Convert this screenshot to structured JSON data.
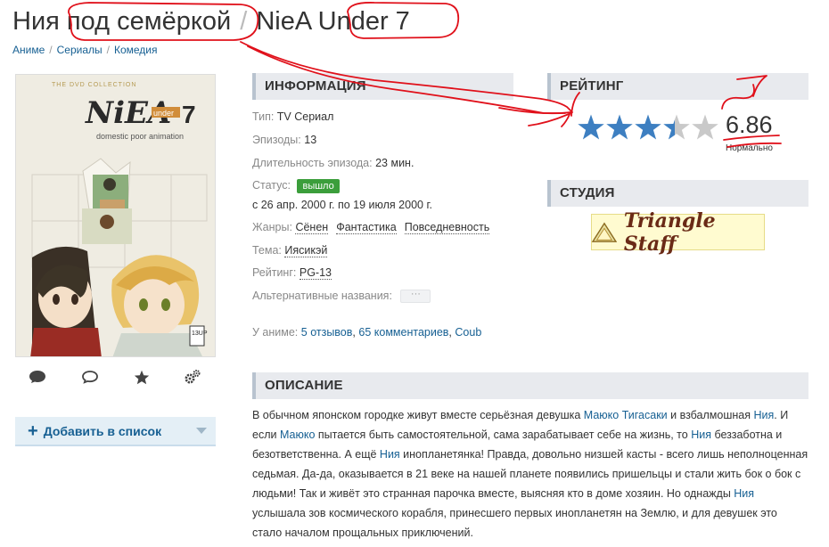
{
  "header": {
    "title_ru": "Ния под семёркой",
    "separator": "/",
    "title_en": "NieA Under 7"
  },
  "breadcrumbs": [
    "Аниме",
    "Сериалы",
    "Комедия"
  ],
  "poster": {
    "collection_text": "THE DVD COLLECTION",
    "logo_main": "NiEA",
    "logo_sub": "under",
    "logo_num": "7",
    "tagline": "domestic poor animation",
    "rating_stamp": "13UP"
  },
  "poster_icons": [
    "comment-icon",
    "comments-icon",
    "star-icon",
    "gears-icon"
  ],
  "add_to_list": {
    "label": "Добавить в список"
  },
  "info": {
    "heading": "ИНФОРМАЦИЯ",
    "type_label": "Тип:",
    "type_value": "TV Сериал",
    "episodes_label": "Эпизоды:",
    "episodes_value": "13",
    "duration_label": "Длительность эпизода:",
    "duration_value": "23 мин.",
    "status_label": "Статус:",
    "status_value": "вышло",
    "dates": "с 26 апр. 2000 г. по 19 июля 2000 г.",
    "genres_label": "Жанры:",
    "genres": [
      "Сёнен",
      "Фантастика",
      "Повседневность"
    ],
    "theme_label": "Тема:",
    "theme_value": "Иясикэй",
    "rating_label": "Рейтинг:",
    "rating_value": "PG-13",
    "alt_names_label": "Альтернативные названия:",
    "alt_names_button": "···",
    "in_anime_label": "У аниме:",
    "in_anime_links": [
      "5 отзывов",
      "65 комментариев",
      "Coub"
    ],
    "link_separator": ","
  },
  "rating": {
    "heading": "РЕЙТИНГ",
    "score": "6.86",
    "score_label": "Нормально",
    "stars_filled": 3.43,
    "stars_total": 5,
    "star_color": "#3d7fc1",
    "star_empty_color": "#c9c9c9"
  },
  "studio": {
    "heading": "СТУДИЯ",
    "name": "Triangle Staff"
  },
  "description": {
    "heading": "ОПИСАНИЕ",
    "parts": [
      {
        "t": "В обычном японском городке живут вместе серьёзная девушка "
      },
      {
        "t": "Маюко Тигасаки",
        "link": true
      },
      {
        "t": " и взбалмошная "
      },
      {
        "t": "Ния",
        "link": true
      },
      {
        "t": ". И если "
      },
      {
        "t": "Маюко",
        "link": true
      },
      {
        "t": " пытается быть самостоятельной, сама зарабатывает себе на жизнь, то "
      },
      {
        "t": "Ния",
        "link": true
      },
      {
        "t": " беззаботна и безответственна. А ещё "
      },
      {
        "t": "Ния",
        "link": true
      },
      {
        "t": " инопланетянка! Правда, довольно низшей касты - всего лишь неполноценная седьмая. Да-да, оказывается в 21 веке на нашей планете появились пришельцы и стали жить бок о бок с людьми! Так и живёт это странная парочка вместе, выясняя кто в доме хозяин. Но однажды "
      },
      {
        "t": "Ния",
        "link": true
      },
      {
        "t": " услышала зов космического корабля, принесшего первых инопланетян на Землю, и для девушек это стало началом прощальных приключений."
      }
    ]
  },
  "annotation": {
    "handwritten": "7",
    "color": "#e0101a"
  },
  "colors": {
    "link": "#176093",
    "status_badge": "#3b9e3b",
    "section_bg": "#e8eaee"
  }
}
